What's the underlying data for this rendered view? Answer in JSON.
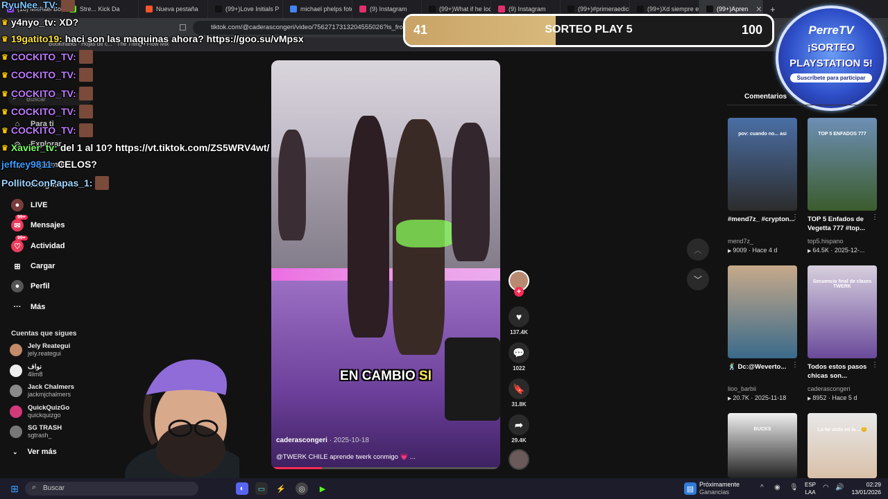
{
  "browser": {
    "tabs": [
      {
        "label": "(18) Michael Bolt...",
        "color": "#9146ff"
      },
      {
        "label": "Stre... Kick Da",
        "color": "#53fc18"
      },
      {
        "label": "Nueva pestaña",
        "color": "#fb542b"
      },
      {
        "label": "(99+)Love Initials P",
        "color": "#111111"
      },
      {
        "label": "michael phelps foto",
        "color": "#4285f4"
      },
      {
        "label": "(9) Instagram",
        "color": "#e1306c"
      },
      {
        "label": "(99+)What if he loo",
        "color": "#111111"
      },
      {
        "label": "(9) Instagram",
        "color": "#e1306c"
      },
      {
        "label": "(99+)#primeraedici",
        "color": "#111111"
      },
      {
        "label": "(99+)Xd siempre es",
        "color": "#111111"
      },
      {
        "label": "(99+)Apren",
        "color": "#111111",
        "active": true
      }
    ],
    "url": "tiktok.com/@caderascongeri/video/7562717313204555026?is_from",
    "bookmarks": "Bookmarks  ·  Hojas de c...  ·  The Thing • Flow Mix"
  },
  "chat": [
    {
      "user": "RyuNee_TV:",
      "msg": "",
      "color": "#7ec8ff",
      "crown": false,
      "emote": true
    },
    {
      "user": "y4nyo_tv:",
      "msg": "XD?",
      "color": "#ffffff",
      "crown": true,
      "emote": false
    },
    {
      "user": "19gatito19:",
      "msg": "haci son las maquinas ahora? https://goo.su/vMpsx",
      "color": "#ffe23b",
      "crown": true,
      "emote": false
    },
    {
      "user": "COCKITO_TV:",
      "msg": "",
      "color": "#c07bff",
      "crown": true,
      "emote": true
    },
    {
      "user": "COCKITO_TV:",
      "msg": "",
      "color": "#c07bff",
      "crown": true,
      "emote": true
    },
    {
      "user": "COCKITO_TV:",
      "msg": "",
      "color": "#c07bff",
      "crown": true,
      "emote": true
    },
    {
      "user": "COCKITO_TV:",
      "msg": "",
      "color": "#c07bff",
      "crown": true,
      "emote": true
    },
    {
      "user": "COCKITO_TV:",
      "msg": "",
      "color": "#c07bff",
      "crown": true,
      "emote": true
    },
    {
      "user": "Xavier_tv:",
      "msg": "del 1 al 10? https://vt.tiktok.com/ZS5WRV4wt/",
      "color": "#7fff6a",
      "crown": true,
      "emote": false
    },
    {
      "user": "jeffrey9811:",
      "msg": "CELOS?",
      "color": "#3b9bff",
      "crown": false,
      "emote": false
    },
    {
      "user": "PollitoConPapas_1:",
      "msg": "",
      "color": "#9fd4ff",
      "crown": false,
      "emote": true
    }
  ],
  "sidebar": {
    "search_placeholder": "Buscar",
    "items": [
      {
        "label": "Para ti",
        "icon": "home-icon"
      },
      {
        "label": "Explorar",
        "icon": "compass-icon"
      },
      {
        "label": "Siguiendo",
        "icon": "following-icon"
      },
      {
        "label": "Amigos",
        "icon": "friends-icon"
      },
      {
        "label": "LIVE",
        "icon": "live-icon"
      },
      {
        "label": "Mensajes",
        "icon": "messages-icon",
        "badge": "99+"
      },
      {
        "label": "Actividad",
        "icon": "activity-icon",
        "badge": "99+"
      },
      {
        "label": "Cargar",
        "icon": "upload-icon"
      },
      {
        "label": "Perfil",
        "icon": "profile-icon"
      },
      {
        "label": "Más",
        "icon": "more-icon"
      }
    ],
    "following_title": "Cuentas que sigues",
    "following": [
      {
        "name": "Jely Reategui",
        "user": "jely.reategui",
        "color": "#c48a6a"
      },
      {
        "name": "نواف",
        "user": "4lim8",
        "color": "#eeeeee"
      },
      {
        "name": "Jack Chalmers",
        "user": "jackmjchalmers",
        "color": "#8a8a8a"
      },
      {
        "name": "QuickQuizGo",
        "user": "quickquizgo",
        "color": "#d23a7a"
      },
      {
        "name": "SG TRASH",
        "user": "sgtrash_",
        "color": "#777777"
      }
    ],
    "see_more": "Ver más"
  },
  "video": {
    "caption_white": "EN CAMBIO",
    "caption_yellow": "SI",
    "author": "caderascongeri",
    "date": "2025-10-18",
    "description": "@TWERK CHILE aprende twerk conmigo 💗 ...",
    "progress": 0.22,
    "actions": [
      {
        "icon": "heart-icon",
        "glyph": "♥",
        "count": "137.4K"
      },
      {
        "icon": "comment-icon",
        "glyph": "💬",
        "count": "1022"
      },
      {
        "icon": "bookmark-icon",
        "glyph": "🔖",
        "count": "31.8K"
      },
      {
        "icon": "share-icon",
        "glyph": "➦",
        "count": "29.4K"
      }
    ]
  },
  "raffle": {
    "left": "41",
    "title": "SORTEO PLAY 5",
    "right": "100",
    "progress": 0.41
  },
  "badge": {
    "brand": "PerreTV",
    "line1": "¡SORTEO",
    "line2": "PLAYSTATION 5!",
    "sub": "Suscríbete para participar"
  },
  "right_panel": {
    "tab": "Comentarios",
    "videos": [
      {
        "caption": "#mend7z_ #crypton...",
        "user": "mend7z_",
        "views": "9009",
        "age": "Hace 4 d",
        "color1": "#4a6fa5",
        "color2": "#2c2c2c",
        "text": "pov: cuando no... asi"
      },
      {
        "caption": "TOP 5 Enfados de Vegetta 777 #top...",
        "user": "top5.hispano",
        "views": "64.5K",
        "age": "2025-12-...",
        "color1": "#6d8fb5",
        "color2": "#3b5c2c",
        "text": "TOP 5 ENFADOS 777"
      },
      {
        "caption": "🕺 Dc:@Weverto...",
        "user": "lioo_barbii",
        "views": "20.7K",
        "age": "2025-11-18",
        "color1": "#c7a98a",
        "color2": "#3a6a8a",
        "text": ""
      },
      {
        "caption": "Todos estos pasos chicas son...",
        "user": "caderascongeri",
        "views": "8952",
        "age": "Hace 5 d",
        "color1": "#d7d0de",
        "color2": "#6a4a9a",
        "text": "Secuencia final de clases TWERK"
      },
      {
        "caption": "",
        "user": "",
        "views": "",
        "age": "",
        "color1": "#f0f0f0",
        "color2": "#222222",
        "text": "BUCKS"
      },
      {
        "caption": "",
        "user": "",
        "views": "",
        "age": "",
        "color1": "#e8e8e8",
        "color2": "#d8c0a8",
        "text": "Lo he visto en la ...😊"
      }
    ]
  },
  "taskbar": {
    "search": "Buscar",
    "weather_title": "Próximamente",
    "weather_sub": "Ganancias",
    "lang": "ESP",
    "lang_sub": "LAA",
    "time": "02:29",
    "date": "13/01/2026"
  }
}
